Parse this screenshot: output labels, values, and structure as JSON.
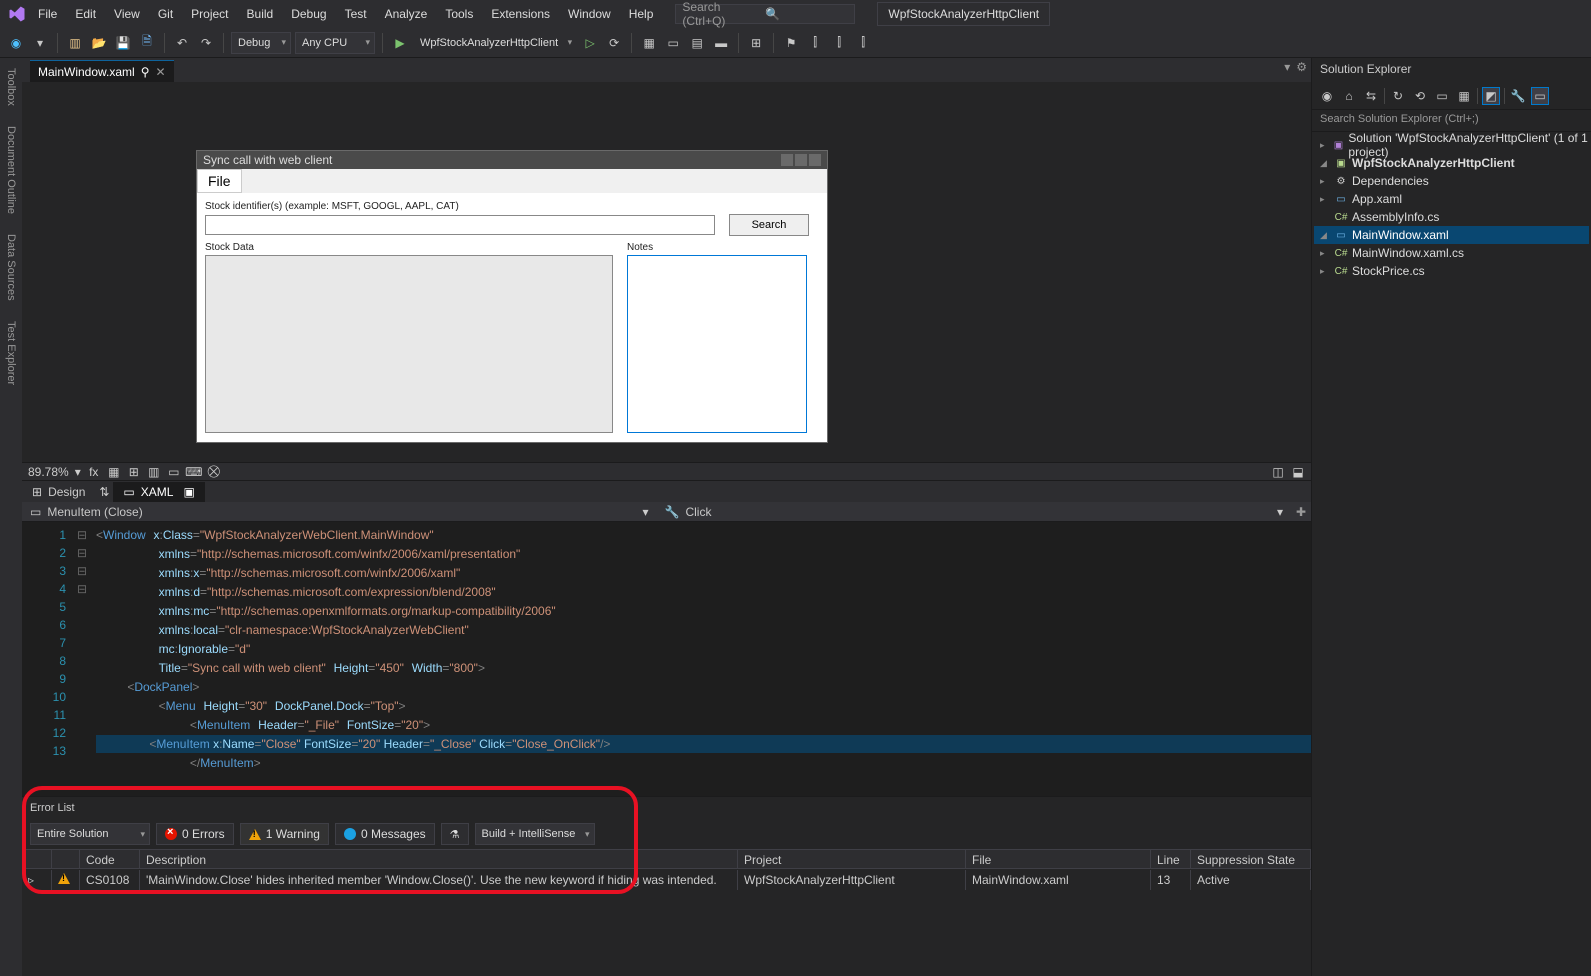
{
  "menu": {
    "items": [
      "File",
      "Edit",
      "View",
      "Git",
      "Project",
      "Build",
      "Debug",
      "Test",
      "Analyze",
      "Tools",
      "Extensions",
      "Window",
      "Help"
    ]
  },
  "search": {
    "placeholder": "Search (Ctrl+Q)"
  },
  "context": "WpfStockAnalyzerHttpClient",
  "toolbar": {
    "config": "Debug",
    "platform": "Any CPU",
    "startup": "WpfStockAnalyzerHttpClient"
  },
  "side_tabs": [
    "Toolbox",
    "Document Outline",
    "Data Sources",
    "Test Explorer"
  ],
  "doc_tab": {
    "name": "MainWindow.xaml"
  },
  "designer": {
    "zoom": "89.78%",
    "window_title": "Sync call with web client",
    "file_menu": "File",
    "stock_label": "Stock identifier(s) (example: MSFT, GOOGL, AAPL, CAT)",
    "search_btn": "Search",
    "stock_data": "Stock Data",
    "notes": "Notes",
    "tab_design": "Design",
    "tab_xaml": "XAML"
  },
  "nav": {
    "left": "MenuItem (Close)",
    "right": "Click"
  },
  "code_lines": [
    1,
    2,
    3,
    4,
    5,
    6,
    7,
    8,
    9,
    10,
    11,
    12,
    13
  ],
  "code": {
    "l1a": "Window",
    "l1b": "x",
    "l1c": "Class",
    "l1d": "\"WpfStockAnalyzerWebClient.MainWindow\"",
    "l2a": "xmlns",
    "l2b": "\"http://schemas.microsoft.com/winfx/2006/xaml/presentation\"",
    "l3a": "xmlns",
    "l3b": "x",
    "l3c": "\"http://schemas.microsoft.com/winfx/2006/xaml\"",
    "l4a": "xmlns",
    "l4b": "d",
    "l4c": "\"http://schemas.microsoft.com/expression/blend/2008\"",
    "l5a": "xmlns",
    "l5b": "mc",
    "l5c": "\"http://schemas.openxmlformats.org/markup-compatibility/2006\"",
    "l6a": "xmlns",
    "l6b": "local",
    "l6c": "\"clr-namespace:WpfStockAnalyzerWebClient\"",
    "l7a": "mc",
    "l7b": "Ignorable",
    "l7c": "\"d\"",
    "l8a": "Title",
    "l8b": "\"Sync call with web client\"",
    "l8c": "Height",
    "l8d": "\"450\"",
    "l8e": "Width",
    "l8f": "\"800\"",
    "l9a": "DockPanel",
    "l10a": "Menu",
    "l10b": "Height",
    "l10c": "\"30\"",
    "l10d": "DockPanel.Dock",
    "l10e": "\"Top\"",
    "l11a": "MenuItem",
    "l11b": "Header",
    "l11c": "\"_File\"",
    "l11d": "FontSize",
    "l11e": "\"20\"",
    "l12a": "MenuItem",
    "l12b": "x",
    "l12c": "Name",
    "l12d": "\"Close\"",
    "l12e": "FontSize",
    "l12f": "\"20\"",
    "l12g": "Header",
    "l12h": "\"_Close\"",
    "l12i": "Click",
    "l12j": "\"Close_OnClick\"",
    "l13a": "MenuItem"
  },
  "error_list": {
    "title": "Error List",
    "scope": "Entire Solution",
    "errors": "0 Errors",
    "warnings": "1 Warning",
    "messages": "0 Messages",
    "build": "Build + IntelliSense",
    "cols": {
      "code": "Code",
      "desc": "Description",
      "proj": "Project",
      "file": "File",
      "line": "Line",
      "state": "Suppression State"
    },
    "row": {
      "code": "CS0108",
      "desc": "'MainWindow.Close' hides inherited member 'Window.Close()'. Use the new keyword if hiding was intended.",
      "proj": "WpfStockAnalyzerHttpClient",
      "file": "MainWindow.xaml",
      "line": "13",
      "state": "Active"
    }
  },
  "solution_explorer": {
    "title": "Solution Explorer",
    "search_ph": "Search Solution Explorer (Ctrl+;)",
    "solution": "Solution 'WpfStockAnalyzerHttpClient' (1 of 1 project)",
    "project": "WpfStockAnalyzerHttpClient",
    "nodes": {
      "deps": "Dependencies",
      "app": "App.xaml",
      "asm": "AssemblyInfo.cs",
      "main": "MainWindow.xaml",
      "maincs": "MainWindow.xaml.cs",
      "stock": "StockPrice.cs"
    }
  }
}
